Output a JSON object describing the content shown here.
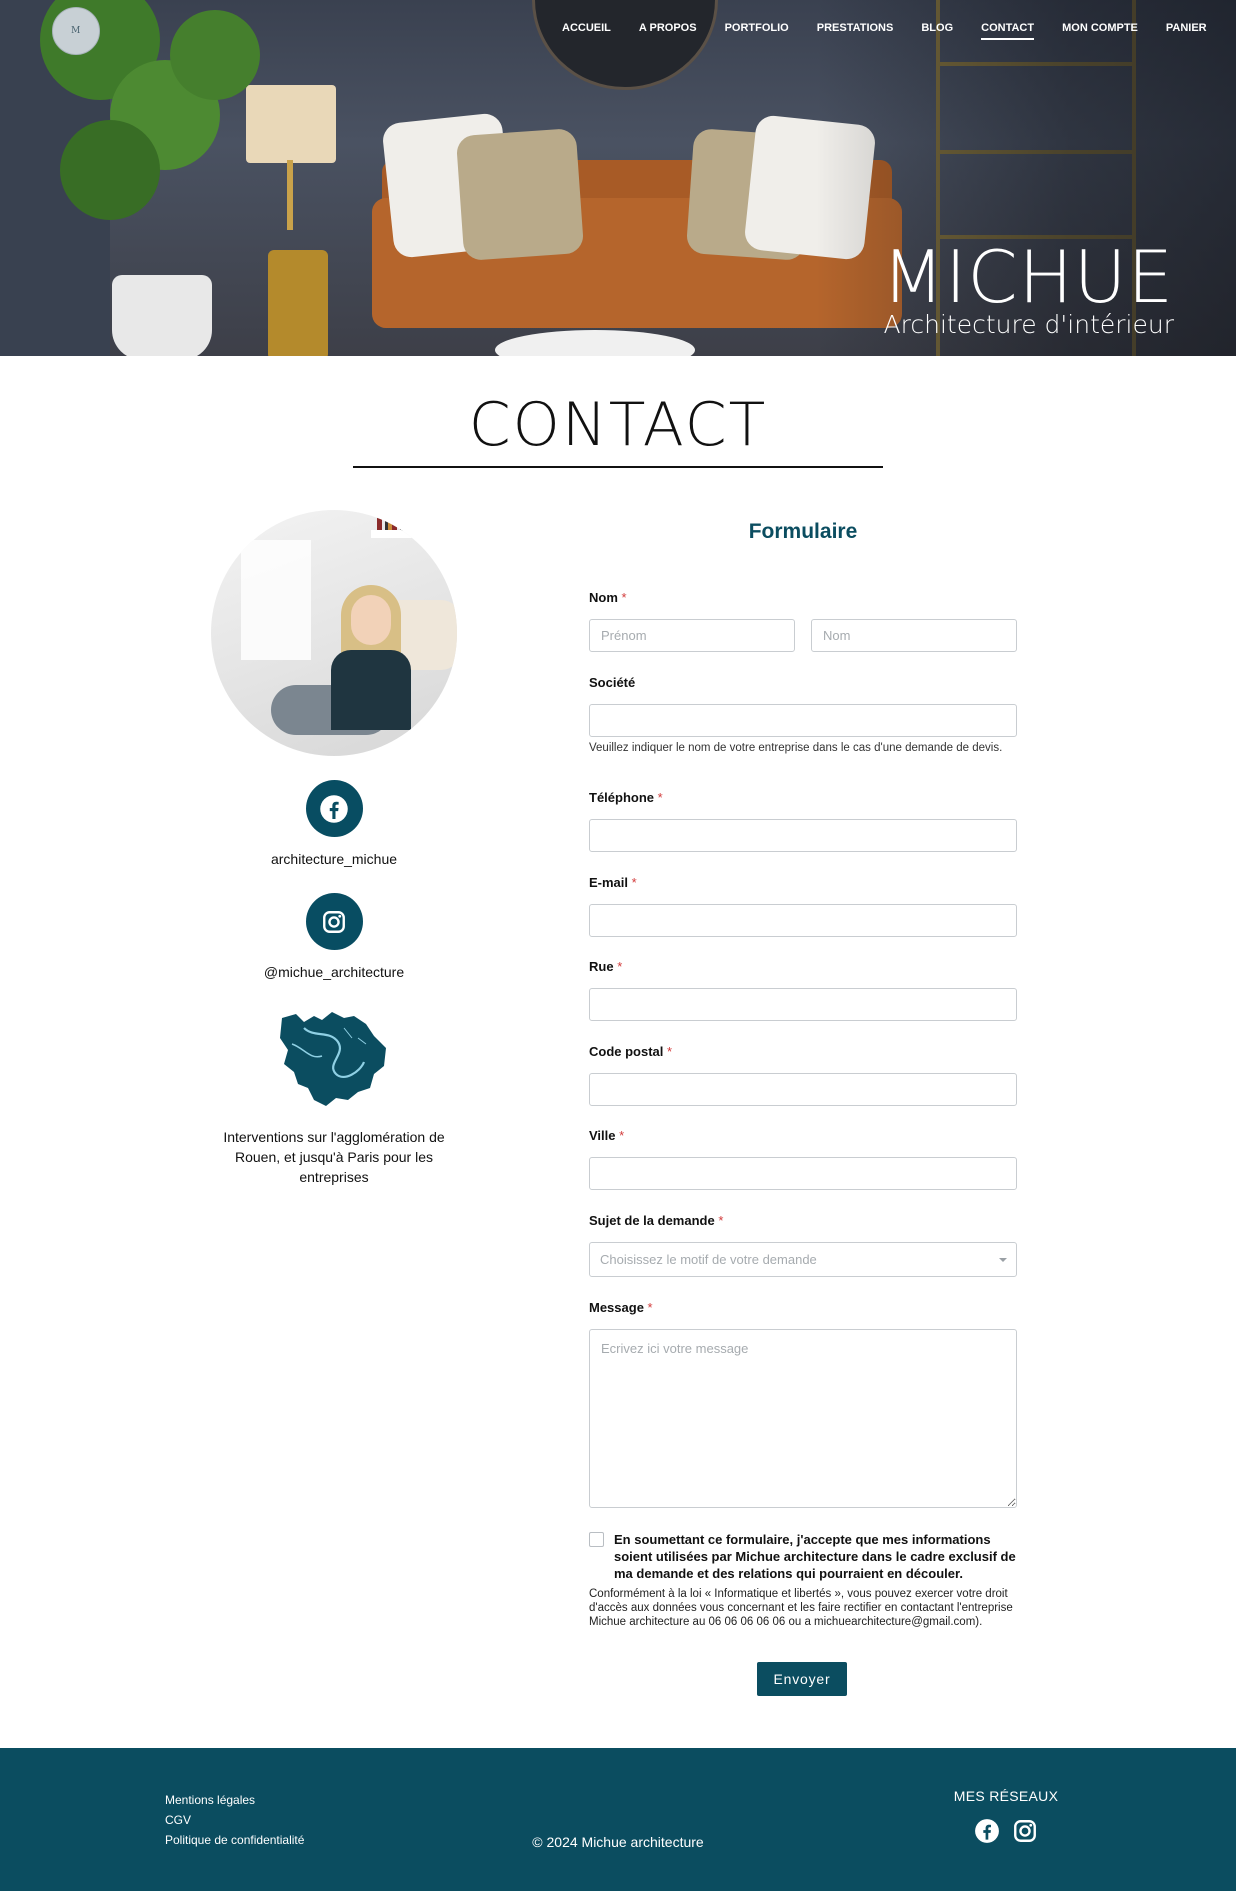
{
  "header": {
    "logo_text": "M",
    "nav": [
      {
        "label": "ACCUEIL"
      },
      {
        "label": "A PROPOS"
      },
      {
        "label": "PORTFOLIO"
      },
      {
        "label": "PRESTATIONS"
      },
      {
        "label": "BLOG"
      },
      {
        "label": "CONTACT",
        "active": true
      },
      {
        "label": "MON COMPTE"
      },
      {
        "label": "PANIER"
      }
    ],
    "brand_title": "MICHUE",
    "brand_subtitle": "Architecture d'intérieur"
  },
  "page": {
    "title": "CONTACT"
  },
  "sidebar": {
    "facebook_icon": "facebook-icon",
    "facebook_label": "architecture_michue",
    "instagram_icon": "instagram-icon",
    "instagram_label": "@michue_architecture",
    "map_icon": "region-map-icon",
    "area_text": "Interventions sur l'agglomération de Rouen, et jusqu'à Paris pour les entreprises"
  },
  "form": {
    "title": "Formulaire",
    "nom": {
      "label": "Nom",
      "required": "*",
      "first_placeholder": "Prénom",
      "last_placeholder": "Nom",
      "first_value": "",
      "last_value": ""
    },
    "societe": {
      "label": "Société",
      "value": "",
      "help": "Veuillez indiquer le nom de votre entreprise dans le cas d'une demande de devis."
    },
    "telephone": {
      "label": "Téléphone",
      "required": "*",
      "value": ""
    },
    "email": {
      "label": "E-mail",
      "required": "*",
      "value": ""
    },
    "rue": {
      "label": "Rue",
      "required": "*",
      "value": ""
    },
    "code_postal": {
      "label": "Code postal",
      "required": "*",
      "value": ""
    },
    "ville": {
      "label": "Ville",
      "required": "*",
      "value": ""
    },
    "sujet": {
      "label": "Sujet de la demande",
      "required": "*",
      "selected": "Choisissez le motif de votre demande"
    },
    "message": {
      "label": "Message",
      "required": "*",
      "placeholder": "Ecrivez ici votre message",
      "value": ""
    },
    "consent": {
      "checked": false,
      "text": "En soumettant ce formulaire, j'accepte que mes informations soient utilisées par Michue architecture dans le cadre exclusif de ma demande et des relations qui pourraient en découler.",
      "legal": "Conformément à la loi « Informatique et libertés », vous pouvez exercer votre droit d'accès aux données vous concernant et les faire rectifier en contactant l'entreprise Michue architecture au 06 06 06 06 06 ou a michuearchitecture@gmail.com)."
    },
    "submit_label": "Envoyer"
  },
  "footer": {
    "links": [
      "Mentions légales",
      "CGV",
      "Politique de confidentialité"
    ],
    "copyright": "© 2024 Michue architecture",
    "reseaux_title": "MES RÉSEAUX",
    "icons": [
      "facebook-icon",
      "instagram-icon"
    ]
  },
  "colors": {
    "accent": "#0b4d60",
    "required": "#d23b3b",
    "footer_bg": "#0b4d60"
  }
}
